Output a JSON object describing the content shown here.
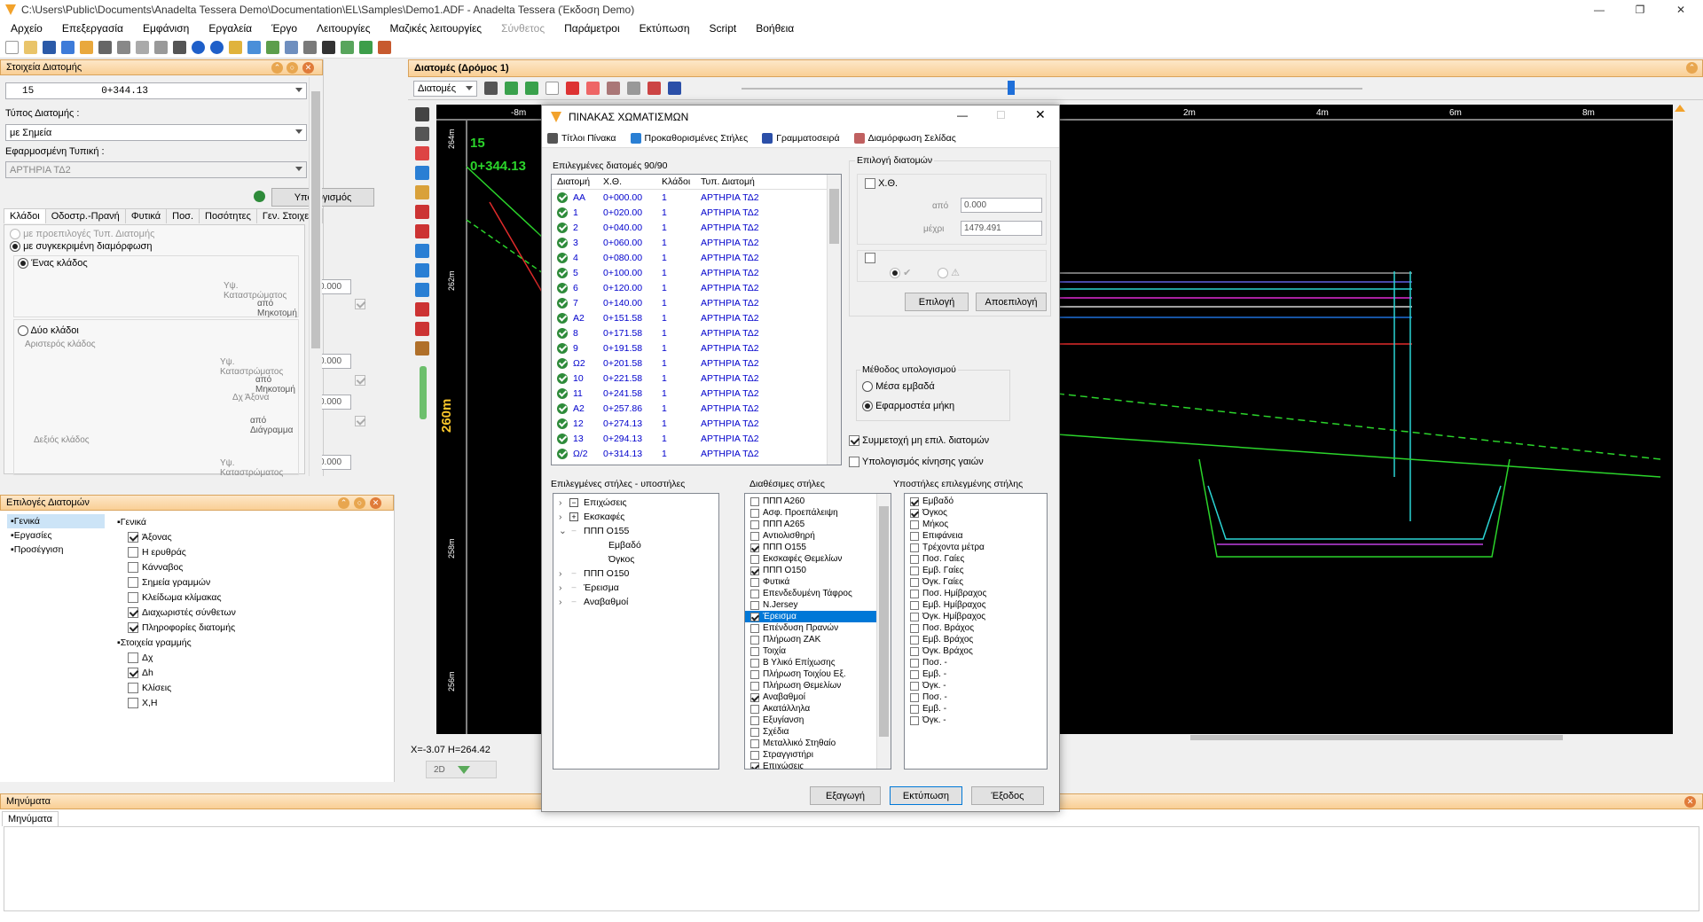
{
  "window": {
    "title": "C:\\Users\\Public\\Documents\\Anadelta Tessera Demo\\Documentation\\EL\\Samples\\Demo1.ADF - Anadelta Tessera (Έκδοση Demo)"
  },
  "menu": [
    "Αρχείο",
    "Επεξεργασία",
    "Εμφάνιση",
    "Εργαλεία",
    "Έργο",
    "Λειτουργίες",
    "Μαζικές λειτουργίες",
    "Σύνθετος",
    "Παράμετροι",
    "Εκτύπωση",
    "Script",
    "Βοήθεια"
  ],
  "left_panel": {
    "title": "Στοιχεία Διατομής",
    "section_no": "15",
    "section_ch": "0+344.13",
    "type_label": "Τύπος Διατομής  :",
    "type_value": "με Σημεία",
    "applied_label": "Εφαρμοσμένη Τυπική :",
    "applied_value": "ΑΡΤΗΡΙΑ ΤΔ2",
    "calc_button": "Υπολογισμός",
    "tabs": [
      "Κλάδοι",
      "Οδοστρ.-Πρανή",
      "Φυτικά",
      "Ποσ.",
      "Ποσότητες",
      "Γεν. Στοιχεία"
    ],
    "radio_defaults": "με προεπιλογές Τυπ. Διατομής",
    "radio_specific": "με συγκεκριμένη διαμόρφωση",
    "one_branch": "Ένας κλάδος",
    "two_branch": "Δύο κλάδοι",
    "left_branch": "Αριστερός κλάδος",
    "right_branch": "Δεξιός κλάδος",
    "embankment_height": "Υψ. Καταστρώματος",
    "from_profile": "από Μηκοτομή",
    "dx_axis": "Δχ Άξονα",
    "from_diagram": "από Διάγραμμα",
    "zero": "0.000"
  },
  "options_panel": {
    "title": "Επιλογές Διατομών",
    "left_items": [
      "Γενικά",
      "Εργασίες",
      "Προσέγγιση"
    ],
    "group_general": "Γενικά",
    "general": [
      {
        "label": "Άξονας",
        "on": true
      },
      {
        "label": "Η ερυθράς",
        "on": false
      },
      {
        "label": "Κάνναβος",
        "on": false
      },
      {
        "label": "Σημεία γραμμών",
        "on": false
      },
      {
        "label": "Κλείδωμα κλίμακας",
        "on": false
      },
      {
        "label": "Διαχωριστές σύνθετων",
        "on": true
      },
      {
        "label": "Πληροφορίες διατομής",
        "on": true
      }
    ],
    "group_line": "Στοιχεία γραμμής",
    "line": [
      {
        "label": "Δχ",
        "on": false
      },
      {
        "label": "Δh",
        "on": true
      },
      {
        "label": "Κλίσεις",
        "on": false
      },
      {
        "label": "Χ,Η",
        "on": false
      }
    ]
  },
  "main": {
    "title": "Διατομές (Δρόμος 1)",
    "dropdown": "Διατομές",
    "ruler": [
      "-8m",
      "2m",
      "4m",
      "6m",
      "8m"
    ],
    "station": "15",
    "chainage": "0+344.13",
    "vlabels": [
      "264m",
      "262m",
      "260m",
      "258m",
      "256m"
    ],
    "coords": "X=-3.07  H=264.42",
    "view": "2D"
  },
  "dialog": {
    "title": "ΠΙΝΑΚΑΣ ΧΩΜΑΤΙΣΜΩΝ",
    "tools": [
      "Τίτλοι Πίνακα",
      "Προκαθορισμένες Στήλες",
      "Γραμματοσειρά",
      "Διαμόρφωση Σελίδας"
    ],
    "sel_label": "Επιλεγμένες διατομές 90/90",
    "columns": [
      "Διατομή",
      "Χ.Θ.",
      "Κλάδοι",
      "Τυπ. Διατομή"
    ],
    "rows": [
      [
        "AA",
        "0+000.00",
        "1",
        "ΑΡΤΗΡΙΑ ΤΔ2"
      ],
      [
        "1",
        "0+020.00",
        "1",
        "ΑΡΤΗΡΙΑ ΤΔ2"
      ],
      [
        "2",
        "0+040.00",
        "1",
        "ΑΡΤΗΡΙΑ ΤΔ2"
      ],
      [
        "3",
        "0+060.00",
        "1",
        "ΑΡΤΗΡΙΑ ΤΔ2"
      ],
      [
        "4",
        "0+080.00",
        "1",
        "ΑΡΤΗΡΙΑ ΤΔ2"
      ],
      [
        "5",
        "0+100.00",
        "1",
        "ΑΡΤΗΡΙΑ ΤΔ2"
      ],
      [
        "6",
        "0+120.00",
        "1",
        "ΑΡΤΗΡΙΑ ΤΔ2"
      ],
      [
        "7",
        "0+140.00",
        "1",
        "ΑΡΤΗΡΙΑ ΤΔ2"
      ],
      [
        "A2",
        "0+151.58",
        "1",
        "ΑΡΤΗΡΙΑ ΤΔ2"
      ],
      [
        "8",
        "0+171.58",
        "1",
        "ΑΡΤΗΡΙΑ ΤΔ2"
      ],
      [
        "9",
        "0+191.58",
        "1",
        "ΑΡΤΗΡΙΑ ΤΔ2"
      ],
      [
        "Ω2",
        "0+201.58",
        "1",
        "ΑΡΤΗΡΙΑ ΤΔ2"
      ],
      [
        "10",
        "0+221.58",
        "1",
        "ΑΡΤΗΡΙΑ ΤΔ2"
      ],
      [
        "11",
        "0+241.58",
        "1",
        "ΑΡΤΗΡΙΑ ΤΔ2"
      ],
      [
        "Α2",
        "0+257.86",
        "1",
        "ΑΡΤΗΡΙΑ ΤΔ2"
      ],
      [
        "12",
        "0+274.13",
        "1",
        "ΑΡΤΗΡΙΑ ΤΔ2"
      ],
      [
        "13",
        "0+294.13",
        "1",
        "ΑΡΤΗΡΙΑ ΤΔ2"
      ],
      [
        "Ω/2",
        "0+314.13",
        "1",
        "ΑΡΤΗΡΙΑ ΤΔ2"
      ]
    ],
    "ch_group": "Επιλογή διατομών",
    "ch_label": "Χ.Θ.",
    "from_label": "από",
    "from_val": "0.000",
    "to_label": "μέχρι",
    "to_val": "1479.491",
    "select_btn": "Επιλογή",
    "deselect_btn": "Αποεπιλογή",
    "method_group": "Μέθοδος υπολογισμού",
    "method_avg": "Μέσα εμβαδά",
    "method_len": "Εφαρμοστέα μήκη",
    "participation": "Συμμετοχή μη επιλ. διατομών",
    "earth_move": "Υπολογισμός κίνησης γαιών",
    "cols_label": "Επιλεγμένες στήλες - υποστήλες",
    "tree": [
      {
        "t": "Επιχώσεις",
        "lvl": 0,
        "box": "minus"
      },
      {
        "t": "Εκσκαφές",
        "lvl": 0,
        "box": "plus"
      },
      {
        "t": "ΠΠΠ Ο155",
        "lvl": 0,
        "box": "open"
      },
      {
        "t": "Εμβαδό",
        "lvl": 1
      },
      {
        "t": "Όγκος",
        "lvl": 1
      },
      {
        "t": "ΠΠΠ Ο150",
        "lvl": 0,
        "box": "none"
      },
      {
        "t": "Έρεισμα",
        "lvl": 0,
        "box": "none"
      },
      {
        "t": "Αναβαθμοί",
        "lvl": 0,
        "box": "none"
      }
    ],
    "avail_label": "Διαθέσιμες στήλες",
    "avail": [
      {
        "t": "ΠΠΠ Α260",
        "on": false
      },
      {
        "t": "Ασφ. Προεπάλειψη",
        "on": false
      },
      {
        "t": "ΠΠΠ Α265",
        "on": false
      },
      {
        "t": "Αντιολισθηρή",
        "on": false
      },
      {
        "t": "ΠΠΠ Ο155",
        "on": true
      },
      {
        "t": "Εκσκαφές Θεμελίων",
        "on": false
      },
      {
        "t": "ΠΠΠ Ο150",
        "on": true
      },
      {
        "t": "Φυτικά",
        "on": false
      },
      {
        "t": "Επενδεδυμένη Τάφρος",
        "on": false
      },
      {
        "t": "N.Jersey",
        "on": false
      },
      {
        "t": "Έρεισμα",
        "on": true,
        "sel": true
      },
      {
        "t": "Επένδυση Πρανών",
        "on": false
      },
      {
        "t": "Πλήρωση ΖΑΚ",
        "on": false
      },
      {
        "t": "Τοιχία",
        "on": false
      },
      {
        "t": "Β Υλικό Επίχωσης",
        "on": false
      },
      {
        "t": "Πλήρωση Τοιχίου Εξ.",
        "on": false
      },
      {
        "t": "Πλήρωση Θεμελίων",
        "on": false
      },
      {
        "t": "Αναβαθμοί",
        "on": true
      },
      {
        "t": "Ακατάλληλα",
        "on": false
      },
      {
        "t": "Εξυγίανση",
        "on": false
      },
      {
        "t": "Σχέδια",
        "on": false
      },
      {
        "t": "Μεταλλικό Στηθαίο",
        "on": false
      },
      {
        "t": "Στραγγιστήρι",
        "on": false
      },
      {
        "t": "Επιχώσεις",
        "on": true
      }
    ],
    "sub_label": "Υποστήλες επιλεγμένης στήλης",
    "sub": [
      {
        "t": "Εμβαδό",
        "on": true
      },
      {
        "t": "Όγκος",
        "on": true
      },
      {
        "t": "Μήκος",
        "on": false
      },
      {
        "t": "Επιφάνεια",
        "on": false
      },
      {
        "t": "Τρέχοντα μέτρα",
        "on": false
      },
      {
        "t": "Ποσ. Γαίες",
        "on": false
      },
      {
        "t": "Εμβ. Γαίες",
        "on": false
      },
      {
        "t": "Όγκ. Γαίες",
        "on": false
      },
      {
        "t": "Ποσ. Ημίβραχος",
        "on": false
      },
      {
        "t": "Εμβ. Ημίβραχος",
        "on": false
      },
      {
        "t": "Όγκ. Ημίβραχος",
        "on": false
      },
      {
        "t": "Ποσ. Βράχος",
        "on": false
      },
      {
        "t": "Εμβ. Βράχος",
        "on": false
      },
      {
        "t": "Όγκ. Βράχος",
        "on": false
      },
      {
        "t": "Ποσ.  -",
        "on": false
      },
      {
        "t": "Εμβ.  -",
        "on": false
      },
      {
        "t": "Όγκ.  -",
        "on": false
      },
      {
        "t": "Ποσ.  -",
        "on": false
      },
      {
        "t": "Εμβ.  -",
        "on": false
      },
      {
        "t": "Όγκ.  -",
        "on": false
      }
    ],
    "export_btn": "Εξαγωγή",
    "print_btn": "Εκτύπωση",
    "exit_btn": "Έξοδος"
  },
  "messages": {
    "title": "Μηνύματα",
    "tab": "Μηνύματα"
  }
}
